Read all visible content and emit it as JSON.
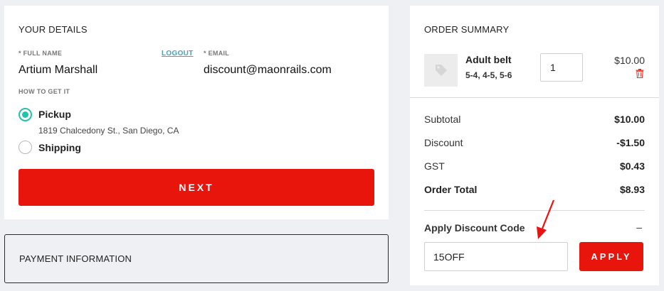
{
  "details": {
    "title": "YOUR DETAILS",
    "full_name_label": "* FULL NAME",
    "full_name": "Artium Marshall",
    "logout": "LOGOUT",
    "email_label": "* EMAIL",
    "email": "discount@maonrails.com",
    "how_label": "HOW TO GET IT",
    "pickup_label": "Pickup",
    "pickup_address": "1819 Chalcedony St., San Diego, CA",
    "shipping_label": "Shipping",
    "next_label": "NEXT"
  },
  "payment": {
    "title": "PAYMENT INFORMATION"
  },
  "summary": {
    "title": "ORDER SUMMARY",
    "item": {
      "name": "Adult belt",
      "variant": "5-4, 4-5, 5-6",
      "quantity": "1",
      "price": "$10.00"
    },
    "rows": [
      {
        "label": "Subtotal",
        "value": "$10.00"
      },
      {
        "label": "Discount",
        "value": "-$1.50"
      },
      {
        "label": "GST",
        "value": "$0.43"
      },
      {
        "label": "Order Total",
        "value": "$8.93"
      }
    ],
    "apply_label": "Apply Discount Code",
    "collapse_symbol": "–",
    "code_value": "15OFF",
    "apply_button": "APPLY"
  },
  "colors": {
    "accent": "#e8150d",
    "radio": "#1fc3b0",
    "link": "#4aa0b5",
    "annotation": "#ee1111"
  },
  "icons": {
    "thumb": "tag-icon",
    "remove": "trash-icon",
    "annotation": "arrow-icon"
  }
}
